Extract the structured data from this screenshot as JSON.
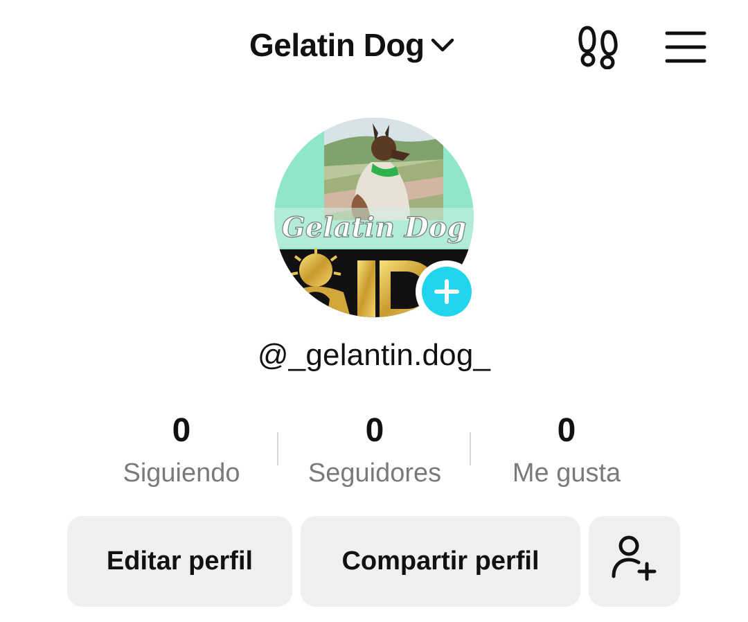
{
  "header": {
    "account_name": "Gelatin Dog",
    "icons": {
      "dropdown": "chevron-down-icon",
      "footprints": "footprints-icon",
      "menu": "hamburger-menu-icon"
    }
  },
  "profile": {
    "avatar_text": "Gelatin Dog",
    "username": "@_gelantin.dog_",
    "add_icon": "plus-icon",
    "accent_color": "#20d5ec"
  },
  "stats": [
    {
      "value": "0",
      "label": "Siguiendo"
    },
    {
      "value": "0",
      "label": "Seguidores"
    },
    {
      "value": "0",
      "label": "Me gusta"
    }
  ],
  "actions": {
    "edit_profile": "Editar perfil",
    "share_profile": "Compartir perfil",
    "add_friends_icon": "add-user-icon"
  }
}
